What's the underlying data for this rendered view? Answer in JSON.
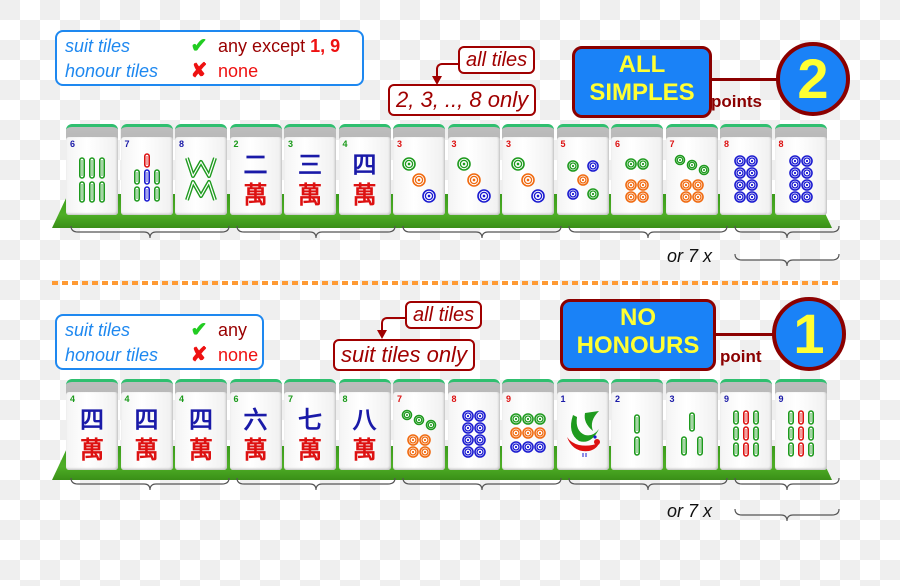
{
  "sections": [
    {
      "id": "all-simples",
      "legend": {
        "suit_label": "suit tiles",
        "suit_mark": "✔",
        "suit_value_prefix": "any except ",
        "suit_value_emph": "1, 9",
        "honour_label": "honour tiles",
        "honour_mark": "✘",
        "honour_value": "none"
      },
      "callout": {
        "top": "all tiles",
        "bottom": "2, 3, .., 8 only"
      },
      "title_line1": "ALL",
      "title_line2": "SIMPLES",
      "points_label": "points",
      "points_value": "2",
      "tiles": [
        {
          "suit": "bamboo",
          "rank": "6"
        },
        {
          "suit": "bamboo",
          "rank": "7"
        },
        {
          "suit": "bamboo",
          "rank": "8"
        },
        {
          "suit": "character",
          "rank": "2",
          "char": "二"
        },
        {
          "suit": "character",
          "rank": "3",
          "char": "三"
        },
        {
          "suit": "character",
          "rank": "4",
          "char": "四"
        },
        {
          "suit": "dots",
          "rank": "3"
        },
        {
          "suit": "dots",
          "rank": "3"
        },
        {
          "suit": "dots",
          "rank": "3"
        },
        {
          "suit": "dots",
          "rank": "5"
        },
        {
          "suit": "dots",
          "rank": "6"
        },
        {
          "suit": "dots",
          "rank": "7"
        },
        {
          "suit": "dots",
          "rank": "8"
        },
        {
          "suit": "dots",
          "rank": "8"
        }
      ],
      "or_label": "or 7 x"
    },
    {
      "id": "no-honours",
      "legend": {
        "suit_label": "suit tiles",
        "suit_mark": "✔",
        "suit_value_prefix": "any",
        "suit_value_emph": "",
        "honour_label": "honour tiles",
        "honour_mark": "✘",
        "honour_value": "none"
      },
      "callout": {
        "top": "all tiles",
        "bottom": "suit tiles only"
      },
      "title_line1": "NO",
      "title_line2": "HONOURS",
      "points_label": "point",
      "points_value": "1",
      "tiles": [
        {
          "suit": "character",
          "rank": "4",
          "char": "四"
        },
        {
          "suit": "character",
          "rank": "4",
          "char": "四"
        },
        {
          "suit": "character",
          "rank": "4",
          "char": "四"
        },
        {
          "suit": "character",
          "rank": "6",
          "char": "六"
        },
        {
          "suit": "character",
          "rank": "7",
          "char": "七"
        },
        {
          "suit": "character",
          "rank": "8",
          "char": "八"
        },
        {
          "suit": "dots",
          "rank": "7"
        },
        {
          "suit": "dots",
          "rank": "8"
        },
        {
          "suit": "dots",
          "rank": "9"
        },
        {
          "suit": "bamboo",
          "rank": "1"
        },
        {
          "suit": "bamboo",
          "rank": "2"
        },
        {
          "suit": "bamboo",
          "rank": "3"
        },
        {
          "suit": "bamboo",
          "rank": "9"
        },
        {
          "suit": "bamboo",
          "rank": "9"
        }
      ],
      "or_label": "or 7 x"
    }
  ],
  "colors": {
    "legend_border": "#1e88f0",
    "title_fill": "#1a82f7",
    "title_text": "#ffff33",
    "accent_dark_red": "#8b0000",
    "divider": "#ff9a33",
    "green": "#1e9a1e",
    "red": "#dd1111",
    "blue": "#1a1ad0",
    "orange": "#f06a10"
  }
}
